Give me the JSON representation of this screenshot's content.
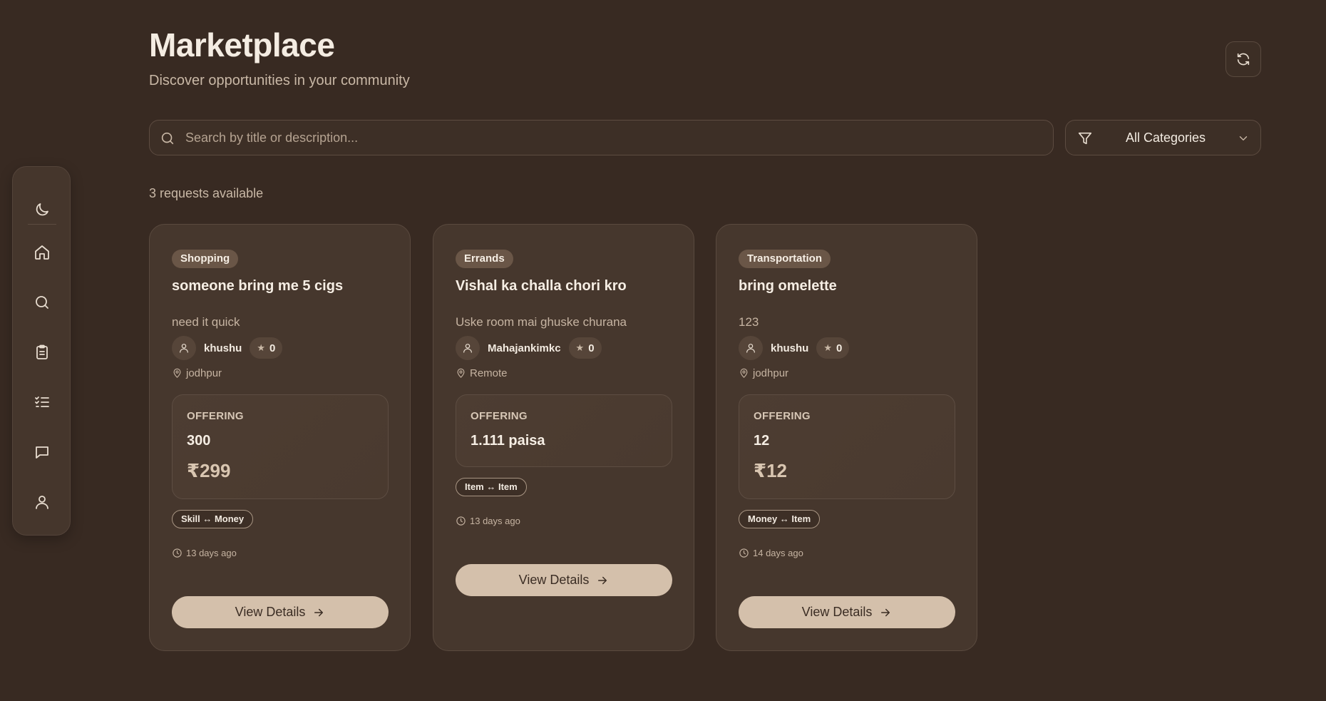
{
  "header": {
    "title": "Marketplace",
    "subtitle": "Discover opportunities in your community"
  },
  "icons": {
    "refresh": "refresh-icon",
    "search": "search-icon",
    "filter": "filter-icon",
    "chevron": "chevron-down-icon"
  },
  "sidebar": {
    "items": [
      {
        "name": "theme-toggle",
        "icon": "moon-icon"
      },
      {
        "name": "home",
        "icon": "home-icon"
      },
      {
        "name": "search",
        "icon": "search-icon"
      },
      {
        "name": "requests",
        "icon": "clipboard-icon"
      },
      {
        "name": "tasks",
        "icon": "checklist-icon"
      },
      {
        "name": "messages",
        "icon": "chat-icon"
      },
      {
        "name": "profile",
        "icon": "user-icon"
      }
    ]
  },
  "search": {
    "placeholder": "Search by title or description...",
    "value": ""
  },
  "filter": {
    "selected": "All Categories"
  },
  "results": {
    "count_text": "3 requests available"
  },
  "cards": [
    {
      "category": "Shopping",
      "title": "someone bring me 5 cigs",
      "description": "need it quick",
      "user": "khushu",
      "rating": "0",
      "location": "jodhpur",
      "offer_label": "OFFERING",
      "offer_value": "300",
      "offer_price": "₹299",
      "exchange": "Skill ↔ Money",
      "time": "13 days ago",
      "button": "View Details"
    },
    {
      "category": "Errands",
      "title": "Vishal ka challa chori kro",
      "description": "Uske room mai ghuske churana",
      "user": "Mahajankimkc",
      "rating": "0",
      "location": "Remote",
      "offer_label": "OFFERING",
      "offer_value": "1.111 paisa",
      "offer_price": "",
      "exchange": "Item ↔ Item",
      "time": "13 days ago",
      "button": "View Details"
    },
    {
      "category": "Transportation",
      "title": "bring omelette",
      "description": "123",
      "user": "khushu",
      "rating": "0",
      "location": "jodhpur",
      "offer_label": "OFFERING",
      "offer_value": "12",
      "offer_price": "₹12",
      "exchange": "Money ↔ Item",
      "time": "14 days ago",
      "button": "View Details"
    }
  ],
  "colors": {
    "background": "#382a22",
    "card": "#46372d",
    "accent_button": "#d4c0ab",
    "text_primary": "#f3ebe1",
    "text_muted": "#c6b4a2"
  }
}
